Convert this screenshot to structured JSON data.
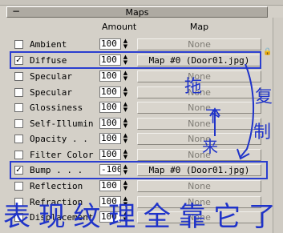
{
  "rollout": {
    "collapse_symbol": "−",
    "title": "Maps"
  },
  "columns": {
    "amount": "Amount",
    "map": "Map"
  },
  "rows": [
    {
      "label": "Ambient",
      "checked": false,
      "amount": "100",
      "map": "None"
    },
    {
      "label": "Diffuse",
      "checked": true,
      "amount": "100",
      "map": "Map #0 (Door01.jpg)"
    },
    {
      "label": "Specular",
      "checked": false,
      "amount": "100",
      "map": "None"
    },
    {
      "label": "Specular",
      "checked": false,
      "amount": "100",
      "map": "None"
    },
    {
      "label": "Glossiness",
      "checked": false,
      "amount": "100",
      "map": "None"
    },
    {
      "label": "Self-Illumin",
      "checked": false,
      "amount": "100",
      "map": "None"
    },
    {
      "label": "Opacity . .",
      "checked": false,
      "amount": "100",
      "map": "None"
    },
    {
      "label": "Filter Color",
      "checked": false,
      "amount": "100",
      "map": "None"
    },
    {
      "label": "Bump  . . .",
      "checked": true,
      "amount": "-100",
      "map": "Map #0 (Door01.jpg)"
    },
    {
      "label": "Reflection",
      "checked": false,
      "amount": "100",
      "map": "None"
    },
    {
      "label": "Refraction",
      "checked": false,
      "amount": "100",
      "map": "None"
    },
    {
      "label": "Displacement",
      "checked": false,
      "amount": "100",
      "map": "None"
    }
  ],
  "annotations": {
    "color": "#1f33c9",
    "highlight_color": "#2a3ecf",
    "handwriting_vertical_1": "拖",
    "handwriting_vertical_2": "下",
    "handwriting_vertical_3": "来",
    "handwriting_right_1": "复",
    "handwriting_right_2": "制",
    "handwriting_bottom": "表现纹理全靠它了"
  }
}
